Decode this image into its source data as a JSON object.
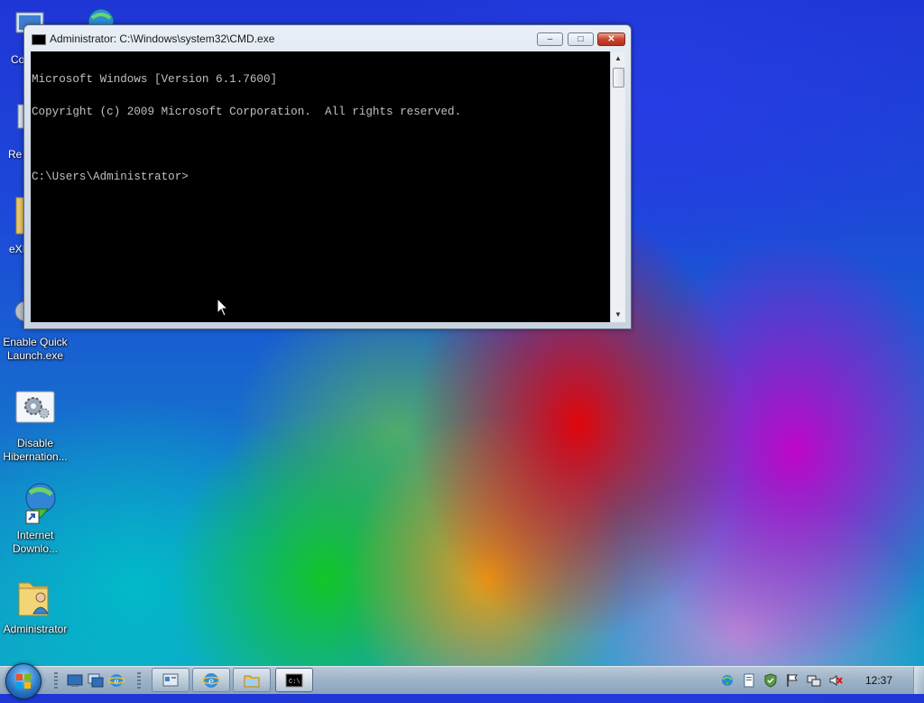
{
  "desktop": {
    "partial_labels": {
      "computer": "Co",
      "recycle": "Re",
      "exe": "eXI"
    },
    "icons": [
      {
        "line1": "Enable Quick",
        "line2": "Launch.exe"
      },
      {
        "line1": "Disable",
        "line2": "Hibernation..."
      },
      {
        "line1": "Internet",
        "line2": "Downlo..."
      },
      {
        "line1": "Administrator",
        "line2": ""
      }
    ]
  },
  "window": {
    "title": "Administrator: C:\\Windows\\system32\\CMD.exe",
    "minimize_glyph": "–",
    "maximize_glyph": "□",
    "close_glyph": "✕",
    "console_lines": [
      "Microsoft Windows [Version 6.1.7600]",
      "Copyright (c) 2009 Microsoft Corporation.  All rights reserved.",
      "",
      "C:\\Users\\Administrator>"
    ],
    "scroll_up_glyph": "▲",
    "scroll_down_glyph": "▼"
  },
  "taskbar": {
    "clock": "12:37",
    "pinned": [
      "show-desktop-quick",
      "switch-windows",
      "internet-explorer"
    ],
    "buttons": [
      "control-panel",
      "internet-explorer",
      "windows-explorer",
      "command-prompt"
    ],
    "tray": [
      "network",
      "notepad",
      "security-center",
      "action-center-flag",
      "network-connection",
      "volume-muted"
    ]
  },
  "colors": {
    "console_bg": "#000000",
    "console_fg": "#c0c0c0",
    "close_button": "#c9452d"
  }
}
